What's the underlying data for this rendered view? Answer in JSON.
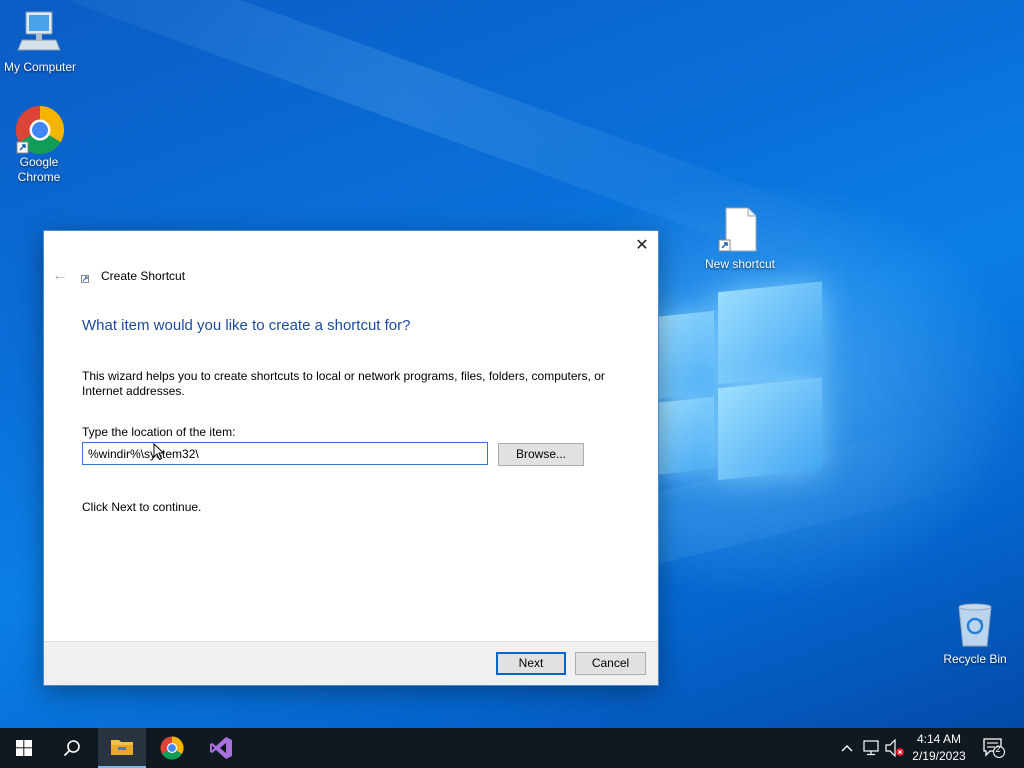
{
  "desktop": {
    "icons": [
      {
        "label": "My Computer",
        "icon": "computer-icon"
      },
      {
        "label": "Google Chrome",
        "icon": "chrome-icon"
      },
      {
        "label": "New shortcut",
        "icon": "shortcut-file-icon"
      },
      {
        "label": "Recycle Bin",
        "icon": "recycle-bin-icon"
      }
    ]
  },
  "dialog": {
    "close_glyph": "✕",
    "back_glyph": "←",
    "title": "Create Shortcut",
    "heading": "What item would you like to create a shortcut for?",
    "description": "This wizard helps you to create shortcuts to local or network programs, files, folders, computers, or Internet addresses.",
    "location_label": "Type the location of the item:",
    "location_value": "%windir%\\system32\\",
    "browse_label": "Browse...",
    "hint": "Click Next to continue.",
    "next_label": "Next",
    "cancel_label": "Cancel"
  },
  "taskbar": {
    "apps": [
      {
        "name": "start",
        "icon": "windows-start-icon"
      },
      {
        "name": "search",
        "icon": "search-icon"
      },
      {
        "name": "file-explorer",
        "icon": "folder-icon",
        "active": true
      },
      {
        "name": "chrome",
        "icon": "chrome-icon"
      },
      {
        "name": "visual-studio",
        "icon": "visual-studio-icon"
      }
    ],
    "time": "4:14 AM",
    "date": "2/19/2023",
    "notification_count": "2"
  },
  "colors": {
    "accent": "#0a64c8",
    "heading": "#1e4a9c",
    "taskbar": "#101820"
  }
}
